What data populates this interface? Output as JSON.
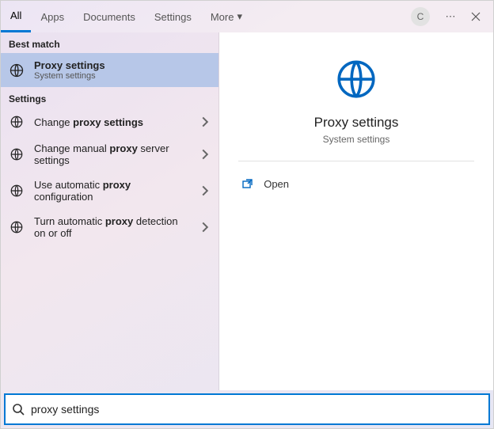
{
  "topbar": {
    "tabs": [
      {
        "label": "All",
        "active": true
      },
      {
        "label": "Apps",
        "active": false
      },
      {
        "label": "Documents",
        "active": false
      },
      {
        "label": "Settings",
        "active": false
      },
      {
        "label": "More",
        "active": false,
        "chevron": true
      }
    ],
    "avatar_letter": "C"
  },
  "left": {
    "best_match_header": "Best match",
    "best_match": {
      "title": "Proxy settings",
      "subtitle": "System settings"
    },
    "settings_header": "Settings",
    "settings": [
      {
        "prefix": "Change ",
        "bold": "proxy settings",
        "suffix": ""
      },
      {
        "prefix": "Change manual ",
        "bold": "proxy",
        "suffix": " server settings"
      },
      {
        "prefix": "Use automatic ",
        "bold": "proxy",
        "suffix": " configuration"
      },
      {
        "prefix": "Turn automatic ",
        "bold": "proxy",
        "suffix": " detection on or off"
      }
    ]
  },
  "right": {
    "title": "Proxy settings",
    "subtitle": "System settings",
    "open_label": "Open"
  },
  "search": {
    "value": "proxy settings",
    "placeholder": ""
  }
}
